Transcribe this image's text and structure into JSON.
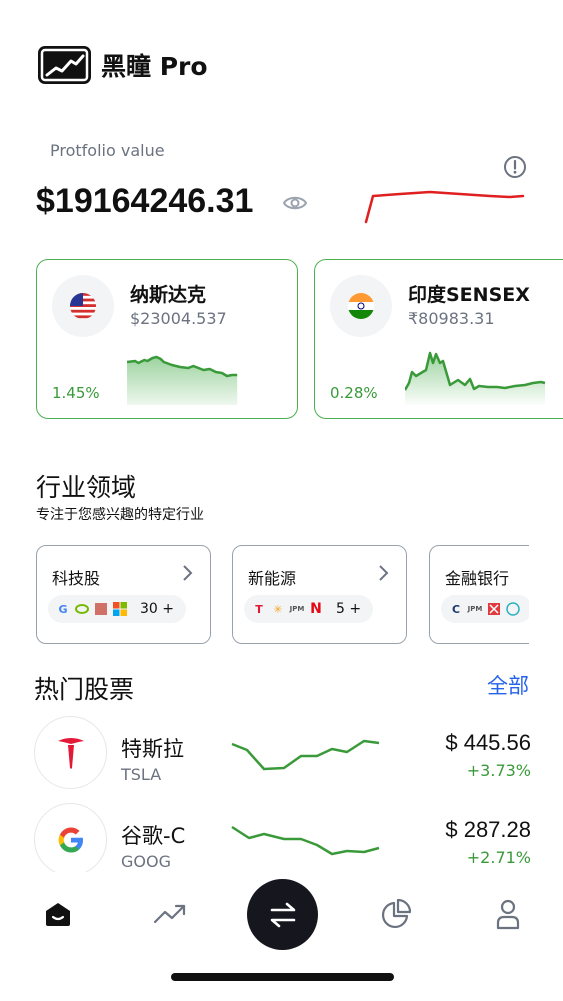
{
  "app": {
    "title": "黑瞳 Pro"
  },
  "portfolio": {
    "label": "Protfolio value",
    "value": "$19164246.31"
  },
  "indices": [
    {
      "name": "纳斯达克",
      "price": "$23004.537",
      "change": "1.45%",
      "flag": "us-flag"
    },
    {
      "name": "印度SENSEX",
      "price": "₹80983.31",
      "change": "0.28%",
      "flag": "india-flag"
    }
  ],
  "sectors": {
    "title": "行业领域",
    "subtitle": "专注于您感兴趣的特定行业",
    "items": [
      {
        "name": "科技股",
        "count": "30 +"
      },
      {
        "name": "新能源",
        "count": "5 +"
      },
      {
        "name": "金融银行",
        "count": ""
      }
    ]
  },
  "hot": {
    "title": "热门股票",
    "all_label": "全部",
    "stocks": [
      {
        "name": "特斯拉",
        "ticker": "TSLA",
        "price": "$ 445.56",
        "change": "+3.73%"
      },
      {
        "name": "谷歌-C",
        "ticker": "GOOG",
        "price": "$ 287.28",
        "change": "+2.71%"
      }
    ]
  },
  "colors": {
    "positive": "#3a9a3a",
    "negative": "#e02020",
    "accent": "#2563eb",
    "card_border": "#4caf50"
  }
}
